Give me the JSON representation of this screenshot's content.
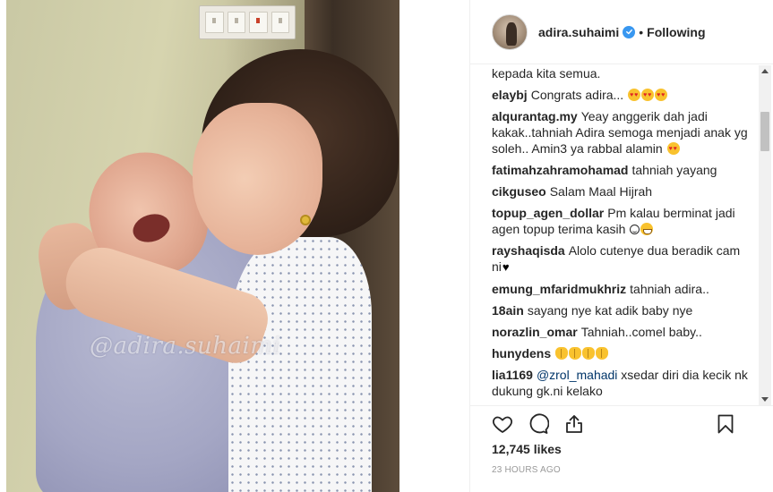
{
  "photo": {
    "watermark": "@adira.suhaimi",
    "alt": "photo"
  },
  "header": {
    "username": "adira.suhaimi",
    "separator": "•",
    "follow_status": "Following"
  },
  "comments": [
    {
      "user": "",
      "text": "kepada kita semua.",
      "emoji": null
    },
    {
      "user": "elaybj",
      "text": "Congrats adira... ",
      "emoji": "heart-eyes x3"
    },
    {
      "user": "alqurantag.my",
      "text": "Yeay anggerik dah jadi kakak..tahniah Adira semoga menjadi anak yg soleh.. Amin3 ya rabbal alamin ",
      "emoji": "heart-eyes"
    },
    {
      "user": "fatimahzahramohamad",
      "text": "tahniah yayang",
      "emoji": null
    },
    {
      "user": "cikguseo",
      "text": "Salam Maal Hijrah",
      "emoji": null
    },
    {
      "user": "topup_agen_dollar",
      "text": "Pm kalau berminat jadi agen topup terima kasih ",
      "emoji": "smile, grin"
    },
    {
      "user": "rayshaqisda",
      "text": "Alolo cutenye dua beradik cam ni",
      "emoji": "black-heart"
    },
    {
      "user": "emung_mfaridmukhriz",
      "text": "tahniah adira..",
      "emoji": null
    },
    {
      "user": "18ain",
      "text": "sayang nye kat adik baby nye",
      "emoji": null
    },
    {
      "user": "norazlin_omar",
      "text": "Tahniah..comel baby..",
      "emoji": null
    },
    {
      "user": "hunydens",
      "text": "",
      "emoji": "hands x4"
    },
    {
      "user": "lia1169",
      "mention": "@zrol_mahadi",
      "text": " xsedar diri dia kecik nk dukung gk.ni kelako",
      "emoji": null
    }
  ],
  "actions": {
    "like_icon": "heart-outline-icon",
    "comment_icon": "comment-bubble-icon",
    "share_icon": "share-upload-icon",
    "save_icon": "bookmark-icon"
  },
  "likes": "12,745 likes",
  "timestamp": "23 HOURS AGO",
  "colors": {
    "verified": "#3897f0",
    "text": "#262626",
    "muted": "#999999",
    "border": "#efefef"
  }
}
